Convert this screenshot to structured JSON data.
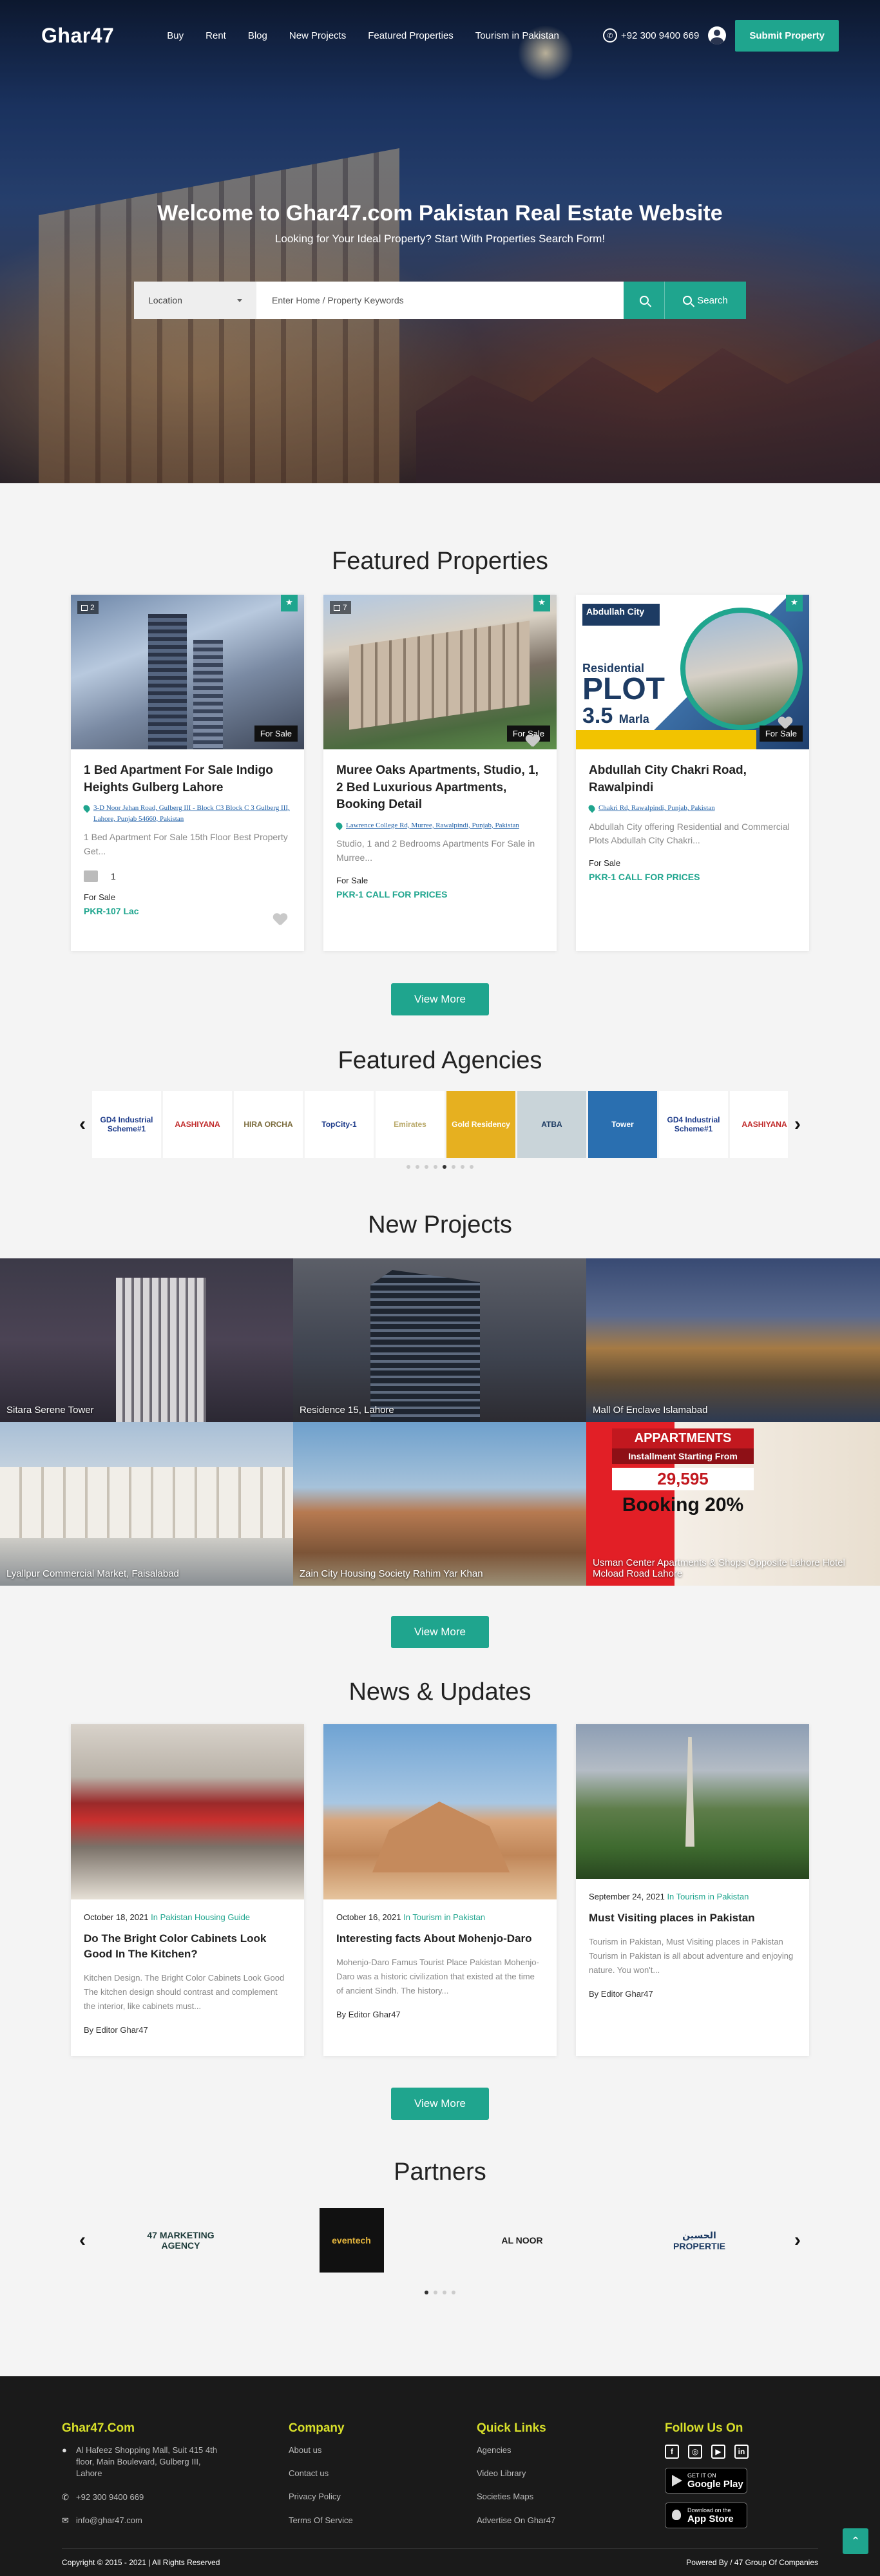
{
  "header": {
    "logo": "Ghar47",
    "nav": [
      "Buy",
      "Rent",
      "Blog",
      "New Projects",
      "Featured Properties",
      "Tourism in Pakistan"
    ],
    "phone": "+92 300 9400 669",
    "submit_label": "Submit Property"
  },
  "hero": {
    "title": "Welcome to Ghar47.com Pakistan Real Estate Website",
    "subtitle": "Looking for Your Ideal Property? Start With Properties Search Form!",
    "location_label": "Location",
    "keyword_placeholder": "Enter Home / Property Keywords",
    "search_label": "Search"
  },
  "featured": {
    "title": "Featured Properties",
    "view_more": "View More",
    "cards": [
      {
        "photo_count": "2",
        "sale_tag": "For Sale",
        "title": "1 Bed Apartment For Sale Indigo Heights Gulberg Lahore",
        "address": "3-D Noor Jehan Road, Gulberg III - Block C3 Block C 3 Gulberg III, Lahore, Punjab 54660, Pakistan",
        "desc": "1 Bed Apartment For Sale 15th Floor Best Property Get...",
        "beds": "1",
        "status": "For Sale",
        "price": "PKR-107 Lac"
      },
      {
        "photo_count": "7",
        "sale_tag": "For Sale",
        "title": "Muree Oaks Apartments, Studio, 1, 2 Bed Luxurious Apartments, Booking Detail",
        "address": "Lawrence College Rd, Murree, Rawalpindi, Punjab, Pakistan",
        "desc": "Studio, 1 and 2 Bedrooms Apartments For Sale in Murree...",
        "status": "For Sale",
        "price": "PKR-1 CALL FOR PRICES"
      },
      {
        "sale_tag": "For Sale",
        "title": "Abdullah City Chakri Road, Rawalpindi",
        "address": "Chakri Rd, Rawalpindi, Punjab, Pakistan",
        "desc": "Abdullah City offering Residential and Commercial Plots Abdullah City Chakri...",
        "status": "For Sale",
        "price": "PKR-1 CALL FOR PRICES",
        "image_text": {
          "brand": "Abdullah City",
          "residential": "Residential",
          "plot": "PLOT",
          "marla": "3.5",
          "marla_unit": "Marla"
        }
      }
    ]
  },
  "agencies": {
    "title": "Featured Agencies",
    "logos": [
      "GD4 Industrial Scheme#1",
      "AASHIYANA",
      "HIRA ORCHA",
      "TopCity-1",
      "Emirates",
      "Gold Residency",
      "ATBA",
      "Tower",
      "GD4 Industrial Scheme#1",
      "AASHIYANA"
    ]
  },
  "projects": {
    "title": "New Projects",
    "view_more": "View More",
    "items": [
      "Sitara Serene Tower",
      "Residence 15, Lahore",
      "Mall Of Enclave Islamabad",
      "Lyallpur Commercial Market, Faisalabad",
      "Zain City Housing Society Rahim Yar Khan",
      "Usman Center Apartments & Shops Opposite Lahore Hotel Mcload Road Lahore"
    ],
    "ad": {
      "line1": "APPARTMENTS",
      "line2": "Installment Starting From",
      "amount": "29,595",
      "booking": "Booking 20%"
    }
  },
  "news": {
    "title": "News & Updates",
    "view_more": "View More",
    "items": [
      {
        "date": "October 18, 2021",
        "in": "In",
        "category": "Pakistan Housing Guide",
        "title": "Do The Bright Color Cabinets Look Good In The Kitchen?",
        "desc": "Kitchen Design. The Bright Color Cabinets Look Good The kitchen design should contrast and complement the interior, like cabinets must...",
        "author": "By   Editor Ghar47"
      },
      {
        "date": "October 16, 2021",
        "in": "In",
        "category": "Tourism in Pakistan",
        "title": "Interesting facts About Mohenjo-Daro",
        "desc": "Mohenjo-Daro Famus Tourist Place Pakistan Mohenjo-Daro was a historic civilization that existed at the time of ancient Sindh. The history...",
        "author": "By   Editor Ghar47"
      },
      {
        "date": "September 24, 2021",
        "in": "In",
        "category": "Tourism in Pakistan",
        "title": "Must Visiting places in Pakistan",
        "desc": "Tourism in Pakistan, Must Visiting places in Pakistan Tourism in Pakistan is all about adventure and enjoying nature. You won't...",
        "author": "By   Editor Ghar47"
      }
    ]
  },
  "partners": {
    "title": "Partners",
    "logos": [
      "47 MARKETING AGENCY",
      "eventech",
      "AL NOOR",
      "الحسين PROPERTIE"
    ]
  },
  "footer": {
    "brand": "Ghar47.Com",
    "address": "Al Hafeez Shopping Mall, Suit 415 4th floor, Main Boulevard, Gulberg III, Lahore",
    "phone": "+92 300 9400 669",
    "email": "info@ghar47.com",
    "company_title": "Company",
    "company_links": [
      "About us",
      "Contact us",
      "Privacy Policy",
      "Terms Of Service"
    ],
    "quick_title": "Quick Links",
    "quick_links": [
      "Agencies",
      "Video Library",
      "Societies Maps",
      "Advertise On Ghar47"
    ],
    "follow_title": "Follow Us On",
    "google_play": {
      "small": "GET IT ON",
      "big": "Google Play"
    },
    "app_store": {
      "small": "Download on the",
      "big": "App Store"
    },
    "copyright": "Copyright © 2015 - 2021 | All Rights Reserved",
    "powered": "Powered By / 47 Group Of Companies"
  },
  "colors": {
    "accent": "#1fa58e",
    "footer_heading": "#d8e02a",
    "footer_bg": "#1a1a1a"
  }
}
